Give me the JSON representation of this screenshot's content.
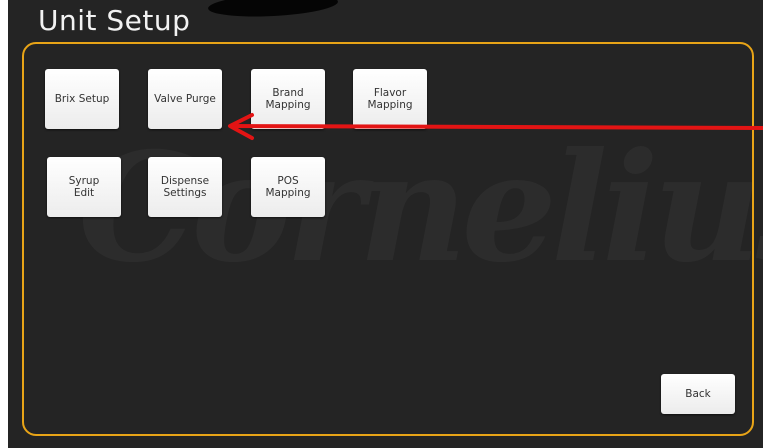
{
  "title": "Unit Setup",
  "watermark": "Cornelius",
  "buttons": {
    "brix_setup": "Brix Setup",
    "valve_purge": "Valve Purge",
    "brand_mapping": "Brand\nMapping",
    "flavor_mapping": "Flavor\nMapping",
    "syrup_edit": "Syrup\nEdit",
    "dispense_settings": "Dispense\nSettings",
    "pos_mapping": "POS\nMapping",
    "back": "Back"
  },
  "colors": {
    "background": "#242424",
    "panel_border": "#e8a417",
    "annotation_arrow": "#e31414"
  },
  "annotation": {
    "icon": "red-arrow-pointing-left"
  }
}
